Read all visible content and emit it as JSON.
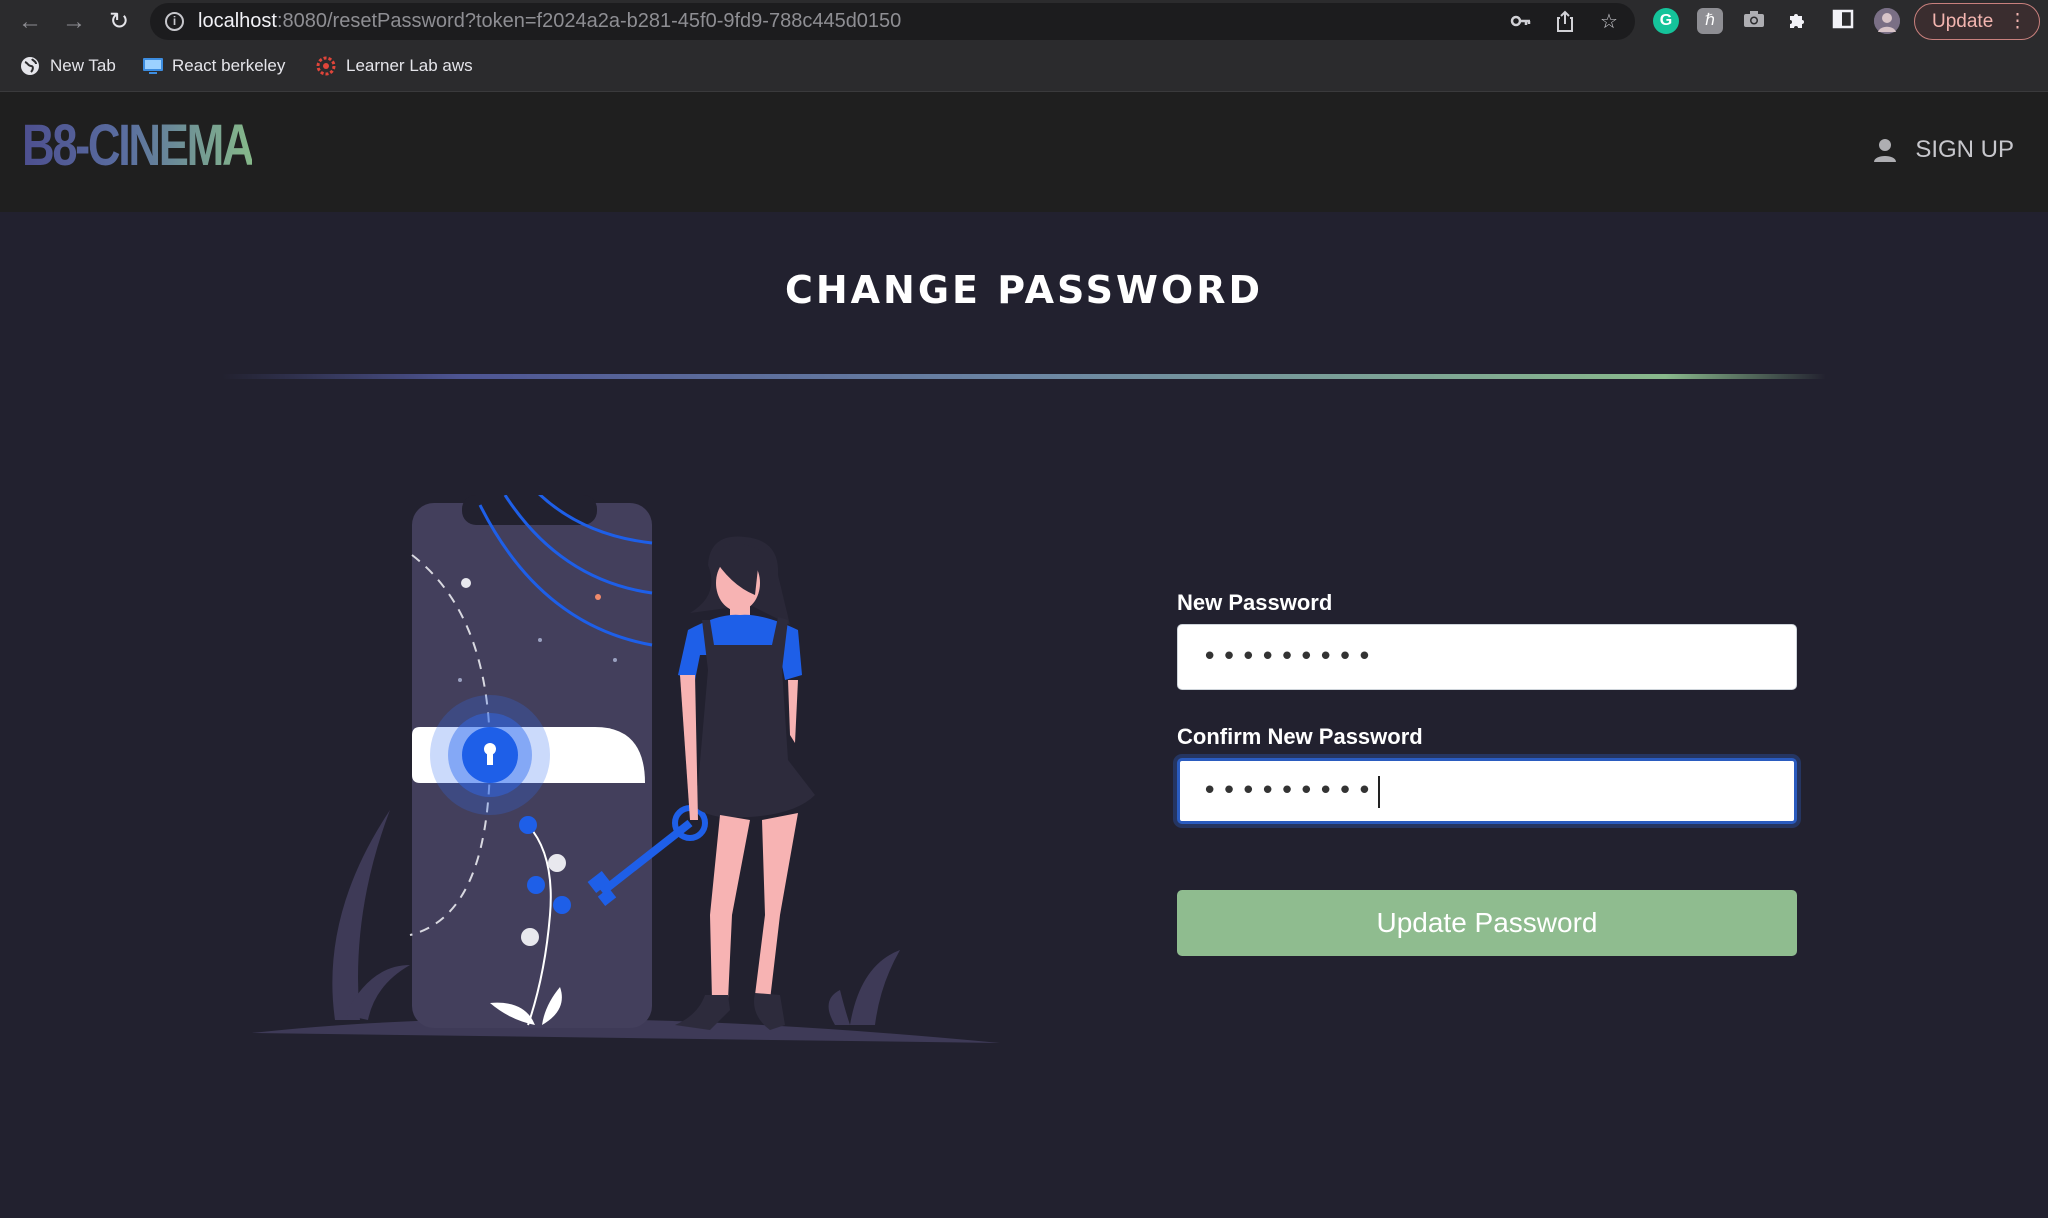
{
  "browser": {
    "url_host": "localhost",
    "url_rest": ":8080/resetPassword?token=f2024a2a-b281-45f0-9fd9-788c445d0150",
    "update_label": "Update",
    "bookmarks": [
      {
        "label": "New Tab"
      },
      {
        "label": "React berkeley"
      },
      {
        "label": "Learner Lab aws"
      }
    ]
  },
  "header": {
    "logo": "B8-CINEMA",
    "signup_label": "SIGN UP"
  },
  "main": {
    "title": "CHANGE PASSWORD",
    "new_password_label": "New Password",
    "new_password_value": "•••••••••",
    "confirm_password_label": "Confirm New Password",
    "confirm_password_value": "•••••••••",
    "submit_label": "Update Password"
  },
  "colors": {
    "page_bg": "#22212f",
    "header_bg": "#1f1f1f",
    "submit_bg": "#8fbc8f",
    "accent_blue": "#2f6bef"
  },
  "icons": [
    "back-arrow-icon",
    "forward-arrow-icon",
    "reload-icon",
    "info-icon",
    "key-icon",
    "share-icon",
    "star-icon",
    "grammarly-icon",
    "extension-icon",
    "camera-icon",
    "puzzle-icon",
    "sidebar-icon",
    "profile-avatar",
    "globe-icon",
    "monitor-icon",
    "aws-icon",
    "user-icon"
  ]
}
